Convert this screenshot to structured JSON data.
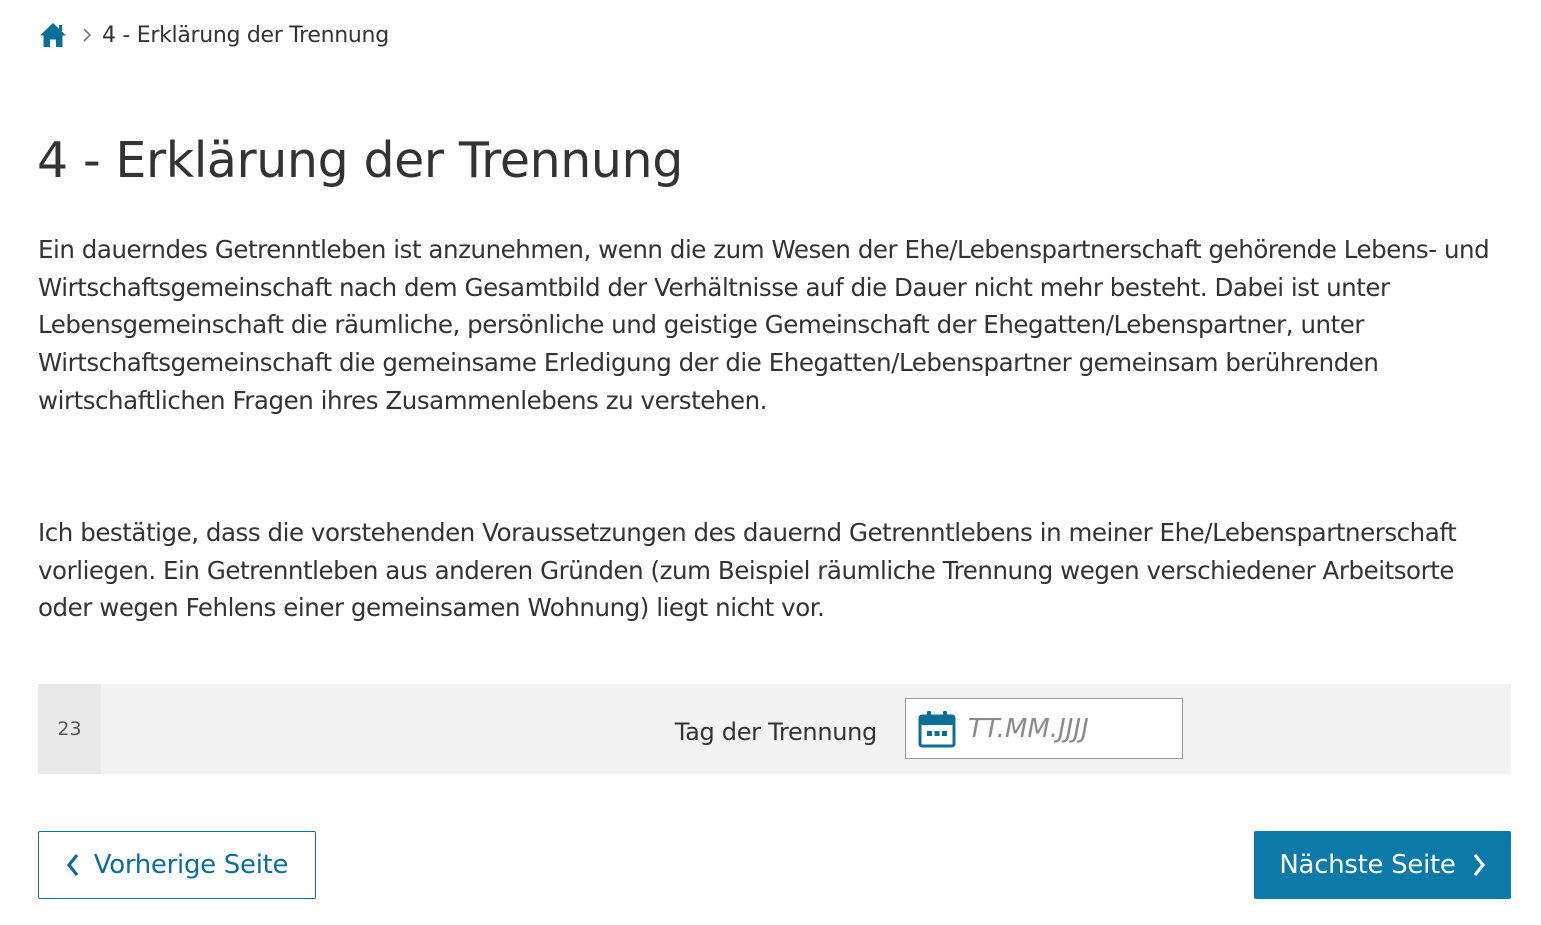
{
  "breadcrumb": {
    "home_icon": "home-icon",
    "separator_icon": "chevron-right-icon",
    "current": "4 - Erklärung der Trennung"
  },
  "page": {
    "title": "4 - Erklärung der Trennung",
    "paragraph1": "Ein dauerndes Getrenntleben ist anzunehmen, wenn die zum Wesen der Ehe/Lebenspartnerschaft gehörende Lebens- und Wirtschaftsgemeinschaft nach dem Gesamtbild der Verhältnisse auf die Dauer nicht mehr besteht. Dabei ist unter Lebensgemeinschaft die räumliche, persönliche und geistige Gemeinschaft der Ehegatten/Lebenspartner, unter Wirtschaftsgemeinschaft die gemeinsame Erledigung der die Ehegatten/Lebenspartner gemeinsam berührenden wirtschaftlichen Fragen ihres Zusammenlebens zu verstehen.",
    "paragraph2": "Ich bestätige, dass die vorstehenden Voraussetzungen des dauernd Getrenntlebens in meiner Ehe/Lebenspartnerschaft vorliegen. Ein Getrenntleben aus anderen Gründen (zum Beispiel räumliche Trennung wegen verschiedener Arbeitsorte oder wegen Fehlens einer gemeinsamen Wohnung) liegt nicht vor."
  },
  "field": {
    "number": "23",
    "label": "Tag der Trennung",
    "value": "",
    "placeholder": "TT.MM.JJJJ",
    "icon": "calendar-icon"
  },
  "navigation": {
    "prev_label": "Vorherige Seite",
    "next_label": "Nächste Seite"
  },
  "colors": {
    "accent": "#0b7aa8",
    "text": "#333333",
    "row_background": "#f2f2f2"
  }
}
